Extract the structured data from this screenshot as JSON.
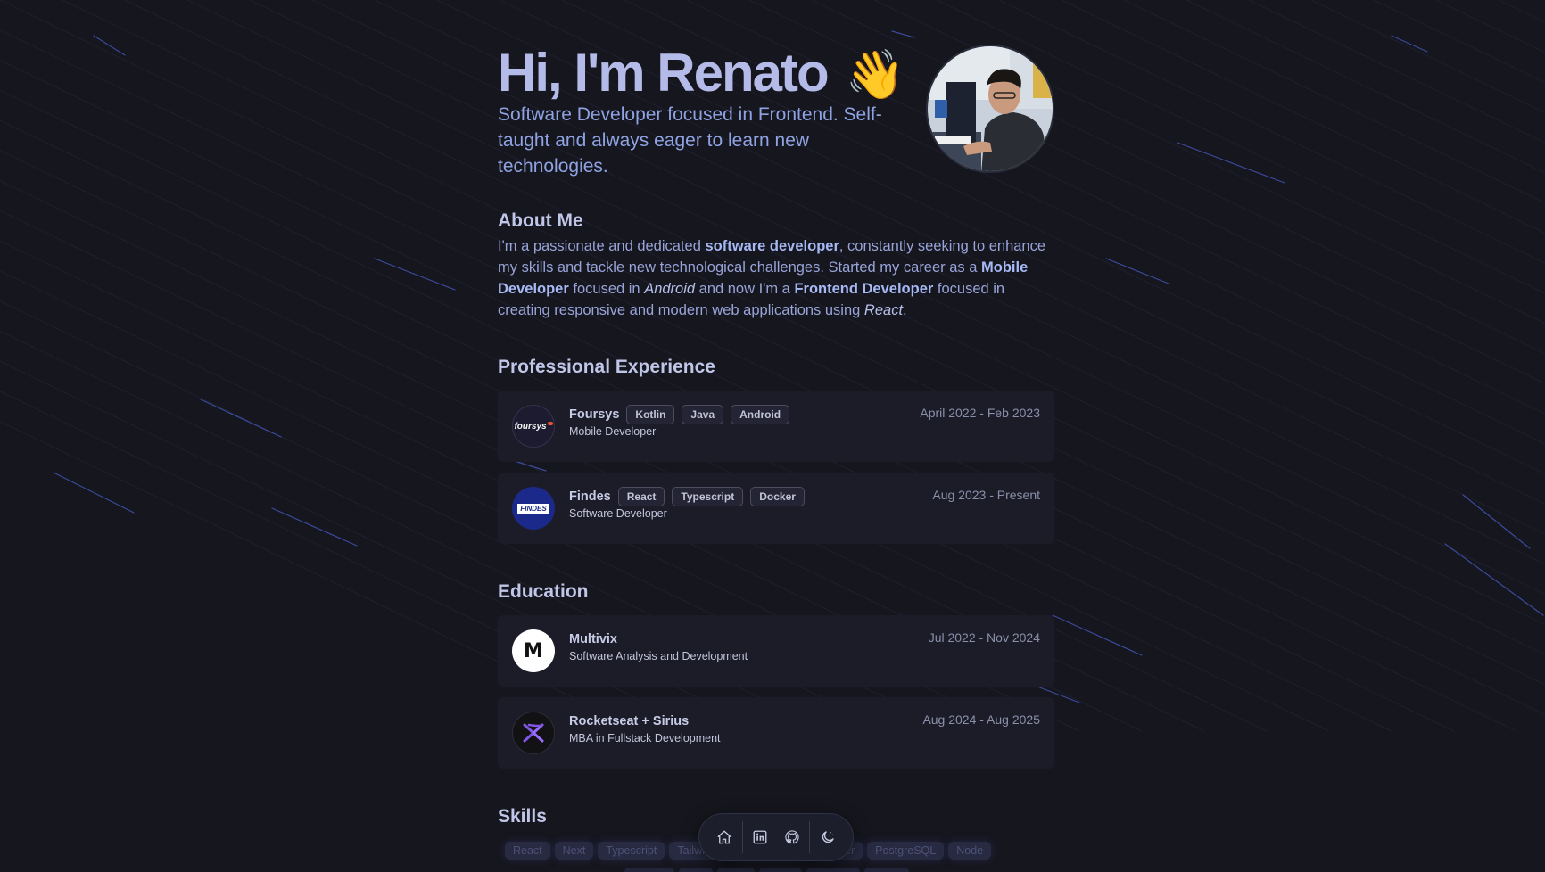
{
  "hero": {
    "title": "Hi, I'm Renato",
    "wave_emoji": "👋",
    "subtitle": "Software Developer focused in Frontend. Self-taught and always eager to learn new technologies."
  },
  "about": {
    "title": "About Me",
    "text_1": "I'm a passionate and dedicated ",
    "bold_1": "software developer",
    "text_2": ", constantly seeking to enhance my skills and tackle new technological challenges. Started my career as a ",
    "bold_2": "Mobile Developer",
    "text_3": " focused in ",
    "italic_1": "Android",
    "text_4": " and now I'm a ",
    "bold_3": "Frontend Developer",
    "text_5": " focused in creating responsive and modern web applications using ",
    "italic_2": "React",
    "text_6": "."
  },
  "experience": {
    "title": "Professional Experience",
    "items": [
      {
        "name": "Foursys",
        "logo_text": "foursys",
        "tags": [
          "Kotlin",
          "Java",
          "Android"
        ],
        "role": "Mobile Developer",
        "date": "April 2022 - Feb 2023"
      },
      {
        "name": "Findes",
        "logo_text": "FINDES",
        "tags": [
          "React",
          "Typescript",
          "Docker"
        ],
        "role": "Software Developer",
        "date": "Aug 2023 - Present"
      }
    ]
  },
  "education": {
    "title": "Education",
    "items": [
      {
        "name": "Multivix",
        "logo_text": "M",
        "role": "Software Analysis and Development",
        "date": "Jul 2022 - Nov 2024"
      },
      {
        "name": "Rocketseat + Sirius",
        "role": "MBA in Fullstack Development",
        "date": "Aug 2024 - Aug 2025"
      }
    ]
  },
  "skills": {
    "title": "Skills",
    "items": [
      "React",
      "Next",
      "Typescript",
      "Tailwind",
      "Docker",
      "PostgreSQL",
      "Node"
    ]
  },
  "dock": {
    "items": [
      "home-icon",
      "linkedin-icon",
      "github-icon",
      "theme-toggle-icon"
    ]
  },
  "colors": {
    "background": "#16161e",
    "card": "#1c1c29",
    "accent": "#8fa3e3",
    "heading": "#b4bbe8"
  }
}
